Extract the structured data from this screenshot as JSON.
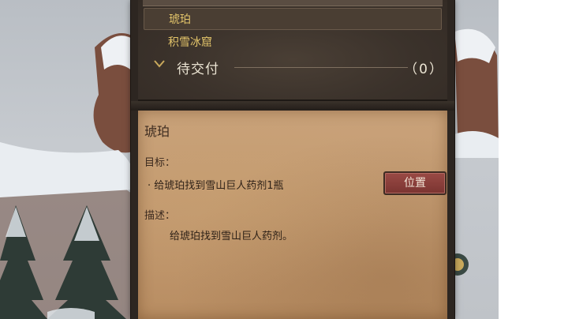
{
  "quest_list": {
    "selected_item": "琥珀",
    "other_item": "积雪冰窟",
    "category": {
      "title": "待交付",
      "count": "（0）"
    }
  },
  "detail": {
    "title": "琥珀",
    "goal_label": "目标：",
    "goal_text": "· 给琥珀找到雪山巨人药剂1瓶",
    "location_button": "位置",
    "desc_label": "描述：",
    "desc_text": "给琥珀找到雪山巨人药剂。"
  },
  "colors": {
    "accent_gold": "#e3c46a",
    "parchment": "#c9a27a",
    "button_red": "#8a3e3a",
    "panel_dark": "#2d2621"
  },
  "icons": {
    "category_toggle": "chevron-down-icon"
  }
}
